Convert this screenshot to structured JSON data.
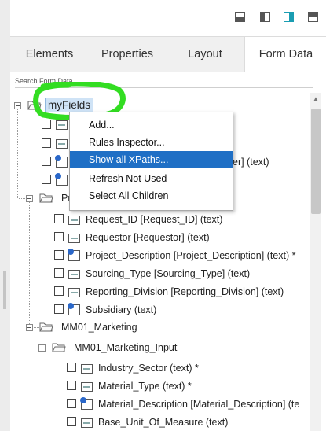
{
  "toolbar": {
    "icons": [
      "bottom-panel-icon",
      "left-panel-icon",
      "right-panel-icon",
      "top-panel-icon"
    ]
  },
  "tabs": [
    {
      "label": "Elements"
    },
    {
      "label": "Properties"
    },
    {
      "label": "Layout"
    },
    {
      "label": "Form Data",
      "active": true
    }
  ],
  "search": {
    "label": "Search Form Data"
  },
  "tree": {
    "root": "myFields",
    "group1": "Pr",
    "items1": [
      {
        "label": "Request_ID [Request_ID] (text)"
      },
      {
        "label": "Requestor [Requestor] (text)"
      },
      {
        "label": "Project_Description [Project_Description] (text) *"
      },
      {
        "label": "Sourcing_Type [Sourcing_Type] (text)"
      },
      {
        "label": "Reporting_Division [Reporting_Division] (text)"
      },
      {
        "label": "Subsidiary (text)"
      }
    ],
    "partial_row": "er] (text)",
    "group2": "MM01_Marketing",
    "group3": "MM01_Marketing_Input",
    "items2": [
      {
        "label": "Industry_Sector (text) *"
      },
      {
        "label": "Material_Type (text) *"
      },
      {
        "label": "Material_Description [Material_Description] (te"
      },
      {
        "label": "Base_Unit_Of_Measure (text)"
      }
    ]
  },
  "context_menu": [
    {
      "label": "Add..."
    },
    {
      "label": "Rules Inspector..."
    },
    {
      "label": "Show all XPaths...",
      "highlighted": true
    },
    {
      "label": "Refresh Not Used"
    },
    {
      "label": "Select All Children"
    }
  ],
  "colors": {
    "accent": "#1f6fc5",
    "highlight_marker": "#33dd22",
    "teal": "#1a9db2"
  }
}
